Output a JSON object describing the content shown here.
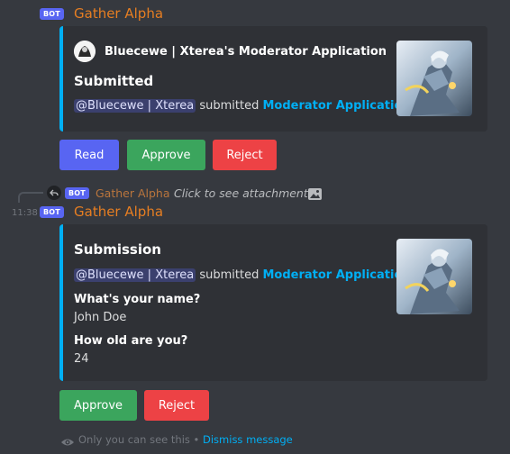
{
  "message1": {
    "bot_tag": "BOT",
    "author": "Gather Alpha",
    "embed": {
      "header_author": "Bluecewe | Xterea's Moderator Application",
      "title": "Submitted",
      "mention": "@Bluecewe | Xterea",
      "middle_text": " submitted ",
      "link_text": "Moderator Application",
      "end_text": "."
    },
    "buttons": {
      "read": "Read",
      "approve": "Approve",
      "reject": "Reject"
    }
  },
  "reply_preview": {
    "bot_tag": "BOT",
    "author": "Gather Alpha",
    "text": "Click to see attachment"
  },
  "message2": {
    "timestamp": "11:38",
    "bot_tag": "BOT",
    "author": "Gather Alpha",
    "embed": {
      "title": "Submission",
      "mention": "@Bluecewe | Xterea",
      "middle_text": " submitted ",
      "link_text": "Moderator Application",
      "end_text": ".",
      "fields": [
        {
          "name": "What's your name?",
          "value": "John Doe"
        },
        {
          "name": "How old are you?",
          "value": "24"
        }
      ]
    },
    "buttons": {
      "approve": "Approve",
      "reject": "Reject"
    }
  },
  "ephemeral": {
    "prefix": "Only you can see this",
    "separator": " • ",
    "dismiss": "Dismiss message"
  },
  "colors": {
    "background": "#36393f",
    "embed_bg": "#2f3136",
    "embed_border": "#00b0f4",
    "author": "#e67e22",
    "blurple": "#5865f2",
    "green": "#3ba55d",
    "red": "#ed4245",
    "link": "#00aff4"
  }
}
